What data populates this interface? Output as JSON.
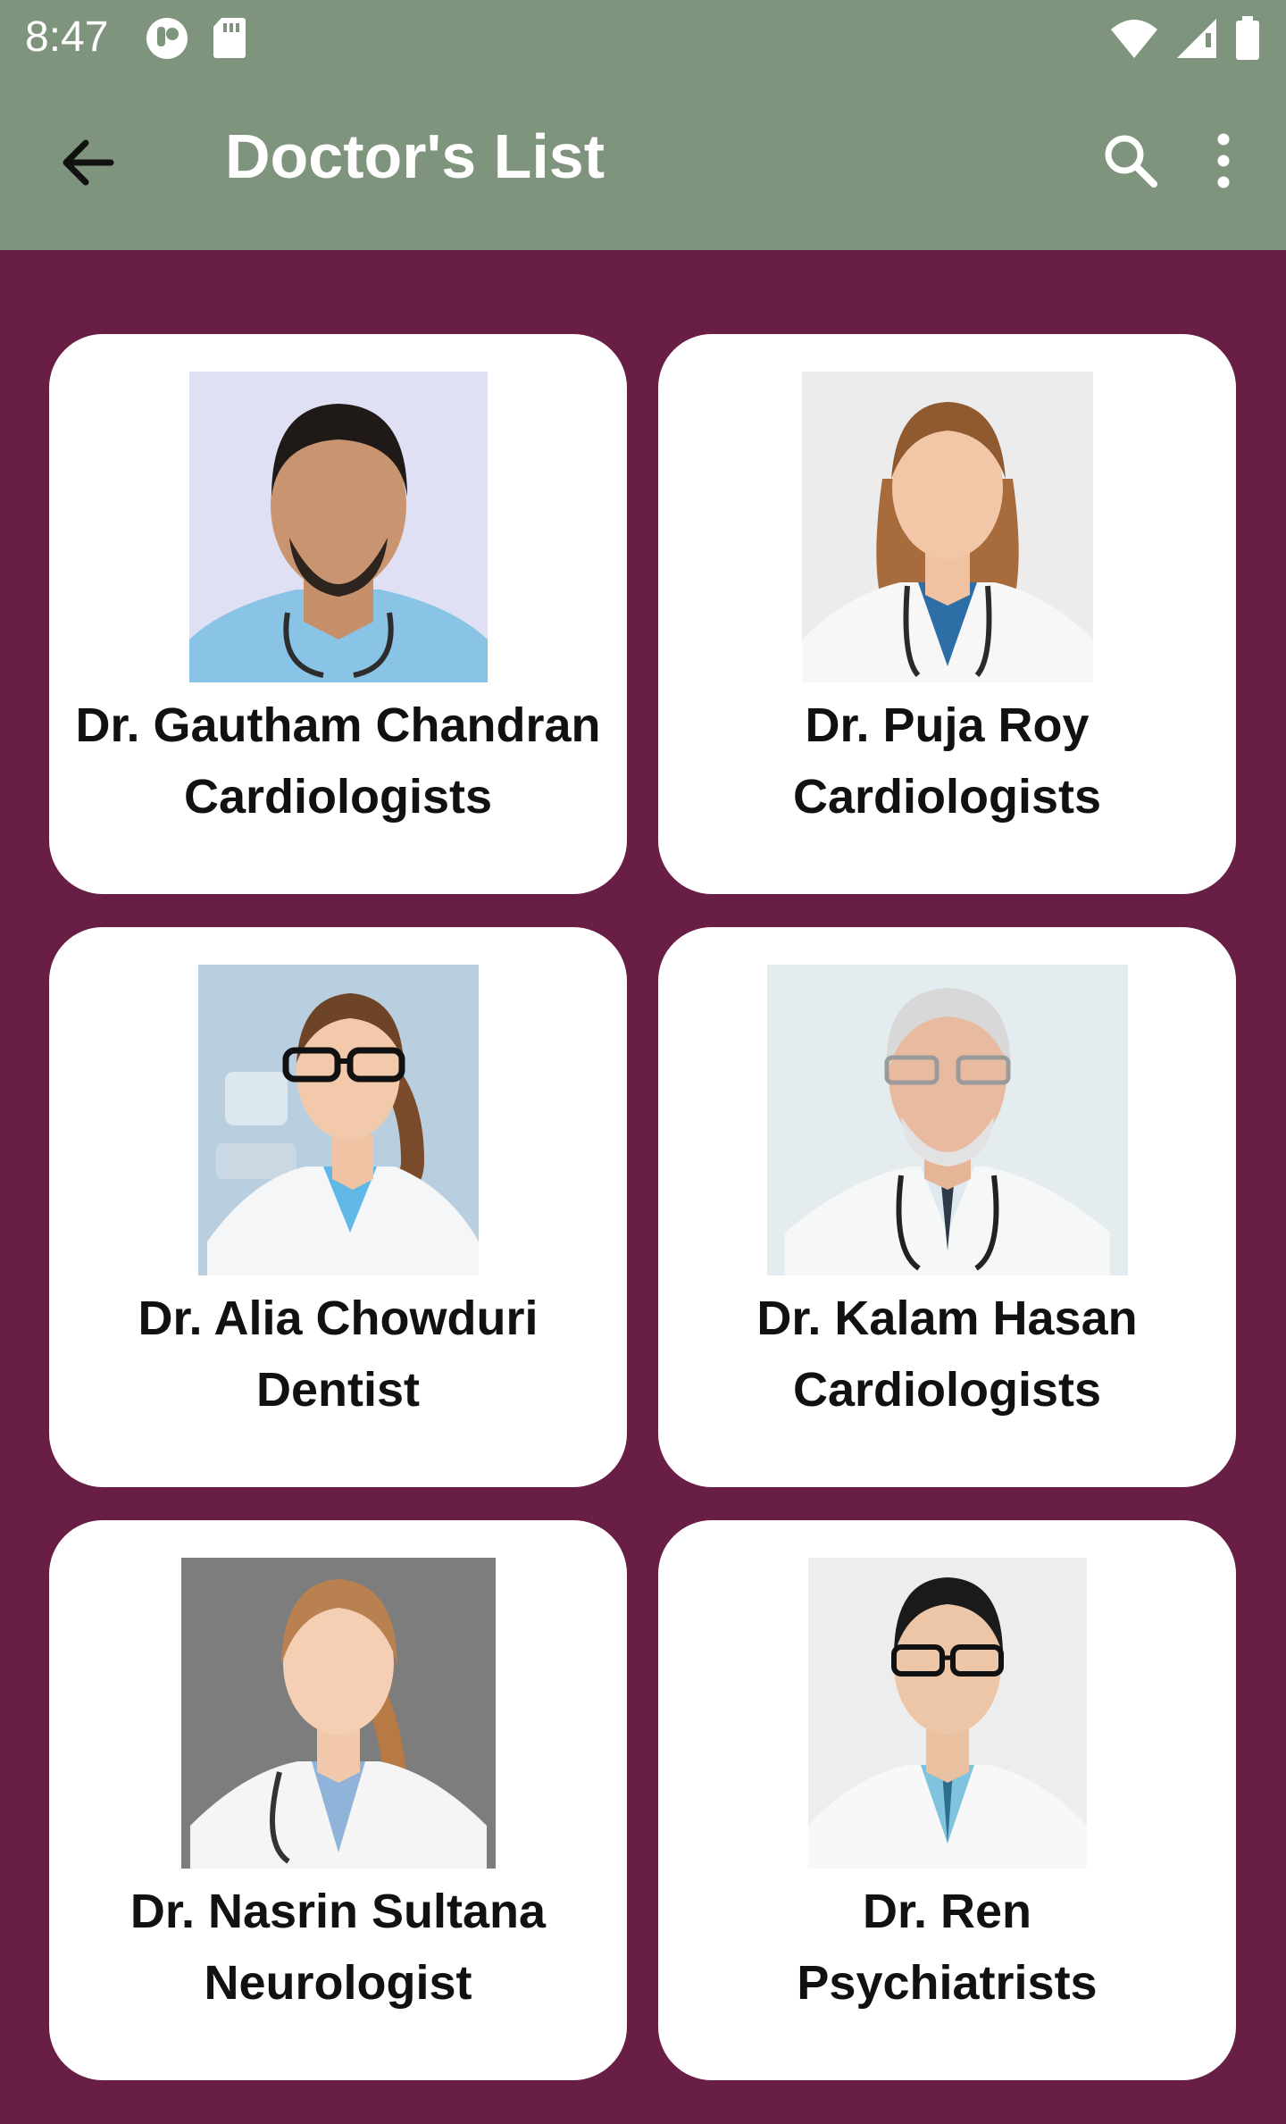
{
  "status_bar": {
    "time": "8:47",
    "left_icons": [
      "circle-notification-icon",
      "sd-card-icon"
    ],
    "right_icons": [
      "wifi-icon",
      "cell-signal-icon",
      "battery-icon"
    ]
  },
  "app_bar": {
    "title": "Doctor's List",
    "back_icon": "arrow-back-icon",
    "search_icon": "search-icon",
    "more_icon": "more-vert-icon"
  },
  "colors": {
    "app_bar": "#7e947d",
    "background": "#691e45",
    "card": "#ffffff"
  },
  "doctors": [
    {
      "name": "Dr. Gautham Chandran",
      "specialty": "Cardiologists"
    },
    {
      "name": "Dr. Puja Roy",
      "specialty": "Cardiologists"
    },
    {
      "name": "Dr. Alia Chowduri",
      "specialty": "Dentist"
    },
    {
      "name": "Dr. Kalam Hasan",
      "specialty": "Cardiologists"
    },
    {
      "name": "Dr. Nasrin Sultana",
      "specialty": "Neurologist"
    },
    {
      "name": "Dr. Ren",
      "specialty": "Psychiatrists"
    }
  ]
}
